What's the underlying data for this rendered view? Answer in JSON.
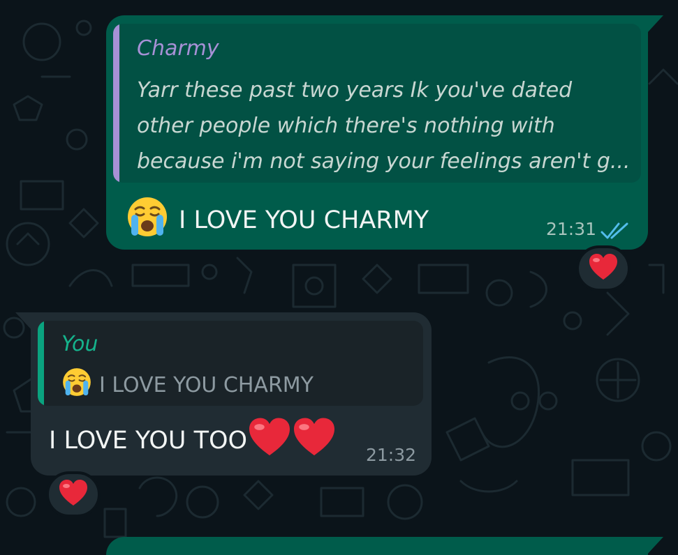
{
  "colors": {
    "background": "#0b141a",
    "outgoing_bubble": "#005c4b",
    "incoming_bubble": "#202c33",
    "quote_name_contact": "#a791d6",
    "quote_name_you": "#15b38c",
    "read_ticks": "#53bdeb"
  },
  "messages": [
    {
      "direction": "outgoing",
      "quoted": {
        "sender": "Charmy",
        "lines": [
          "Yarr these past two years Ik you've dated",
          "other people which there's nothing with",
          "because i'm not saying your feelings aren't g..."
        ]
      },
      "emoji": "loudly-crying-face",
      "text": "I LOVE YOU CHARMY",
      "time": "21:31",
      "status": "read",
      "reaction": "heart"
    },
    {
      "direction": "incoming",
      "quoted": {
        "sender": "You",
        "emoji": "loudly-crying-face",
        "text": "I LOVE YOU CHARMY"
      },
      "text": "I LOVE YOU TOO",
      "trailing_emojis": [
        "heart",
        "heart"
      ],
      "time": "21:32",
      "reaction": "heart"
    }
  ]
}
